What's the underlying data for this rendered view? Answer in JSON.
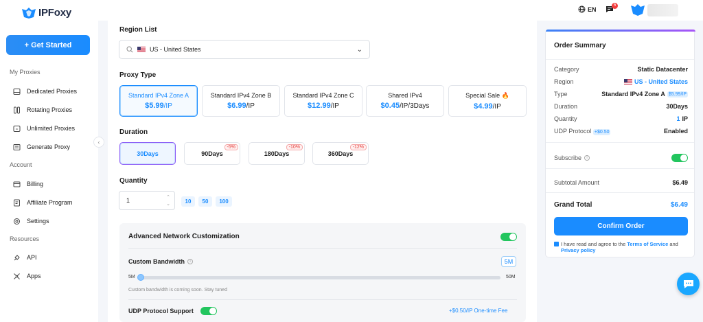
{
  "brand": {
    "name": "IPFoxy"
  },
  "sidebar": {
    "cta_label": "+ Get Started",
    "sections": [
      {
        "title": "My Proxies"
      },
      {
        "title": "Account"
      },
      {
        "title": "Resources"
      }
    ],
    "items": [
      {
        "label": "Dedicated Proxies",
        "icon": "server-icon"
      },
      {
        "label": "Rotating Proxies",
        "icon": "rotate-icon"
      },
      {
        "label": "Unlimited Proxies",
        "icon": "infinity-icon"
      },
      {
        "label": "Generate Proxy",
        "icon": "generate-icon"
      },
      {
        "label": "Billing",
        "icon": "billing-icon"
      },
      {
        "label": "Affiliate Program",
        "icon": "affiliate-icon"
      },
      {
        "label": "Settings",
        "icon": "gear-icon"
      },
      {
        "label": "API",
        "icon": "api-icon"
      },
      {
        "label": "Apps",
        "icon": "apps-icon"
      }
    ]
  },
  "header": {
    "language": "EN",
    "message_count": "5"
  },
  "region": {
    "label": "Region List",
    "value": "US - United States"
  },
  "proxy_type": {
    "label": "Proxy Type",
    "options": [
      {
        "title": "Standard IPv4 Zone A",
        "price": "$5.99",
        "unit": "/IP"
      },
      {
        "title": "Standard IPv4 Zone B",
        "price": "$6.99",
        "unit": "/IP"
      },
      {
        "title": "Standard IPv4 Zone C",
        "price": "$12.99",
        "unit": "/IP"
      },
      {
        "title": "Shared IPv4",
        "price": "$0.45",
        "unit": "/IP/3Days"
      },
      {
        "title": "Special Sale 🔥",
        "price": "$4.99",
        "unit": "/IP"
      }
    ]
  },
  "duration": {
    "label": "Duration",
    "options": [
      {
        "label": "30Days",
        "discount": ""
      },
      {
        "label": "90Days",
        "discount": "-5%"
      },
      {
        "label": "180Days",
        "discount": "-10%"
      },
      {
        "label": "360Days",
        "discount": "-12%"
      }
    ]
  },
  "quantity": {
    "label": "Quantity",
    "value": "1",
    "presets": [
      "10",
      "50",
      "100"
    ]
  },
  "advanced": {
    "title": "Advanced Network Customization",
    "bandwidth_label": "Custom Bandwidth",
    "bandwidth_value": "5M",
    "slider_min": "5M",
    "slider_max": "50M",
    "bandwidth_note": "Custom bandwidth is coming soon. Stay tuned",
    "udp_label": "UDP Protocol Support",
    "udp_fee": "+$0.50/IP One-time Fee"
  },
  "summary": {
    "title": "Order Summary",
    "category_k": "Category",
    "category_v": "Static Datacenter",
    "region_k": "Region",
    "region_v": "US - United States",
    "type_k": "Type",
    "type_v": "Standard IPv4 Zone A",
    "type_tag": "$5.99/IP",
    "duration_k": "Duration",
    "duration_v": "30Days",
    "quantity_k": "Quantity",
    "quantity_num": "1",
    "quantity_unit": "IP",
    "udp_k": "UDP Protocol",
    "udp_tag": "+$0.50",
    "udp_v": "Enabled",
    "subscribe_k": "Subscribe",
    "subtotal_k": "Subtotal Amount",
    "subtotal_v": "$6.49",
    "grand_k": "Grand Total",
    "grand_v": "$6.49",
    "confirm_label": "Confirm Order",
    "agree_text": "I have read and agree to the",
    "tos": "Terms of Service",
    "and": "and",
    "privacy": "Privacy policy"
  },
  "colors": {
    "accent": "#1a8cff",
    "toggle_on": "#22c55e",
    "discount": "#e53935"
  }
}
